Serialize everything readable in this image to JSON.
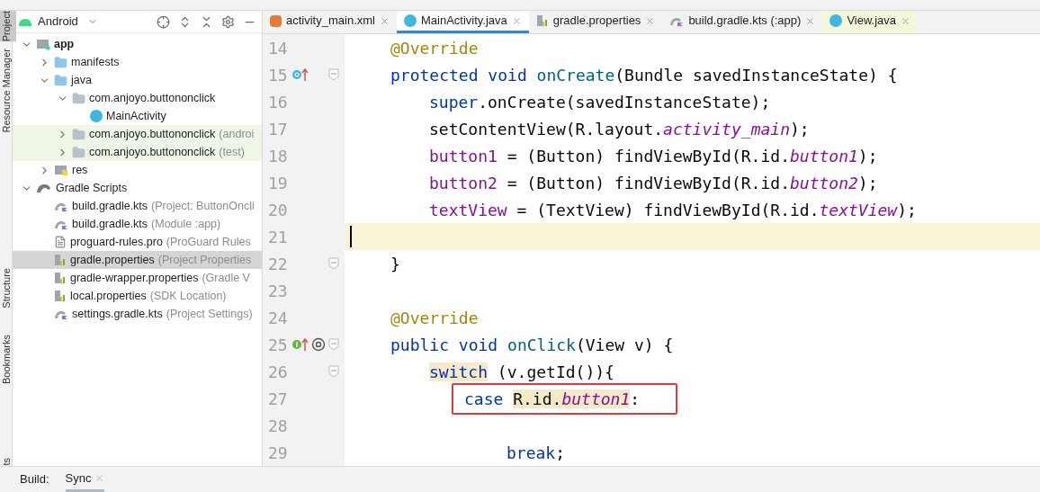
{
  "tool_strip": [
    {
      "label": "Project",
      "selected": true
    },
    {
      "label": "Resource Manager",
      "selected": false
    },
    {
      "label": "Structure",
      "selected": false
    },
    {
      "label": "Bookmarks",
      "selected": false
    },
    {
      "label": "ts",
      "selected": false
    }
  ],
  "project_panel": {
    "view": "Android",
    "tree": [
      {
        "name": "app",
        "kind": "module",
        "expanded": true,
        "selected": false,
        "test": false,
        "children": [
          {
            "name": "manifests",
            "kind": "folder",
            "expanded": false,
            "selected": false,
            "test": false
          },
          {
            "name": "java",
            "kind": "folder",
            "expanded": true,
            "selected": false,
            "test": false,
            "children": [
              {
                "name": "com.anjoyo.buttononclick",
                "kind": "package",
                "expanded": true,
                "selected": false,
                "test": false,
                "children": [
                  {
                    "name": "MainActivity",
                    "kind": "class",
                    "selected": false,
                    "test": false
                  }
                ]
              },
              {
                "name": "com.anjoyo.buttononclick",
                "note": "(androi",
                "kind": "package",
                "expanded": false,
                "selected": false,
                "test": true
              },
              {
                "name": "com.anjoyo.buttononclick",
                "note": "(test)",
                "kind": "package",
                "expanded": false,
                "selected": false,
                "test": true
              }
            ]
          },
          {
            "name": "res",
            "kind": "res",
            "expanded": false,
            "selected": false,
            "test": false
          }
        ]
      },
      {
        "name": "Gradle Scripts",
        "kind": "gradle",
        "expanded": true,
        "selected": false,
        "test": false,
        "children": [
          {
            "name": "build.gradle.kts",
            "note": "(Project: ButtonOncli",
            "kind": "kts",
            "selected": false,
            "test": false
          },
          {
            "name": "build.gradle.kts",
            "note": "(Module :app)",
            "kind": "kts",
            "selected": false,
            "test": false
          },
          {
            "name": "proguard-rules.pro",
            "note": "(ProGuard Rules",
            "kind": "text",
            "selected": false,
            "test": false
          },
          {
            "name": "gradle.properties",
            "note": "(Project Properties",
            "kind": "properties",
            "selected": true,
            "test": false
          },
          {
            "name": "gradle-wrapper.properties",
            "note": "(Gradle V",
            "kind": "properties",
            "selected": false,
            "test": false
          },
          {
            "name": "local.properties",
            "note": "(SDK Location)",
            "kind": "properties",
            "selected": false,
            "test": false
          },
          {
            "name": "settings.gradle.kts",
            "note": "(Project Settings)",
            "kind": "kts",
            "selected": false,
            "test": false
          }
        ]
      }
    ]
  },
  "tabs": [
    {
      "label": "activity_main.xml",
      "kind": "xml",
      "selected": false,
      "readonly": false
    },
    {
      "label": "MainActivity.java",
      "kind": "class",
      "selected": true,
      "readonly": false
    },
    {
      "label": "gradle.properties",
      "kind": "properties",
      "selected": false,
      "readonly": false
    },
    {
      "label": "build.gradle.kts (:app)",
      "kind": "kts",
      "selected": false,
      "readonly": false
    },
    {
      "label": "View.java",
      "kind": "class",
      "selected": false,
      "readonly": true
    }
  ],
  "editor": {
    "lines": [
      {
        "number": "14",
        "kind": "member",
        "current": false,
        "boxed": false,
        "fold": false,
        "tokens": [
          {
            "text": "@Override",
            "kind": "annotation"
          }
        ]
      },
      {
        "number": "15",
        "kind": "member",
        "gutter_icons": [
          {
            "kind": "override"
          }
        ],
        "current": false,
        "boxed": false,
        "fold": true,
        "tokens": [
          {
            "text": "protected void ",
            "kind": "keyword"
          },
          {
            "text": "onCreate",
            "kind": "method"
          },
          {
            "text": "(Bundle savedInstanceState) {"
          }
        ]
      },
      {
        "number": "16",
        "kind": "statement",
        "current": false,
        "boxed": false,
        "fold": false,
        "tokens": [
          {
            "text": "super",
            "kind": "keyword"
          },
          {
            "text": ".onCreate(savedInstanceState);"
          }
        ]
      },
      {
        "number": "17",
        "kind": "statement",
        "current": false,
        "boxed": false,
        "fold": false,
        "tokens": [
          {
            "text": "setContentView(R.layout."
          },
          {
            "text": "activity_main",
            "kind": "static"
          },
          {
            "text": ");"
          }
        ]
      },
      {
        "number": "18",
        "kind": "statement",
        "current": false,
        "boxed": false,
        "fold": false,
        "tokens": [
          {
            "text": "button1",
            "kind": "field"
          },
          {
            "text": " = (Button) findViewById(R.id."
          },
          {
            "text": "button1",
            "kind": "static"
          },
          {
            "text": ");"
          }
        ]
      },
      {
        "number": "19",
        "kind": "statement",
        "current": false,
        "boxed": false,
        "fold": false,
        "tokens": [
          {
            "text": "button2",
            "kind": "field"
          },
          {
            "text": " = (Button) findViewById(R.id."
          },
          {
            "text": "button2",
            "kind": "static"
          },
          {
            "text": ");"
          }
        ]
      },
      {
        "number": "20",
        "kind": "statement",
        "current": false,
        "boxed": false,
        "fold": false,
        "tokens": [
          {
            "text": "textView",
            "kind": "field"
          },
          {
            "text": " = (TextView) findViewById(R.id."
          },
          {
            "text": "textView",
            "kind": "static"
          },
          {
            "text": ");"
          }
        ]
      },
      {
        "number": "21",
        "current": true,
        "boxed": false,
        "fold": false
      },
      {
        "number": "22",
        "kind": "member",
        "current": false,
        "boxed": false,
        "fold": true,
        "tokens": [
          {
            "text": "}"
          }
        ]
      },
      {
        "number": "23",
        "current": false,
        "boxed": false,
        "fold": false
      },
      {
        "number": "24",
        "kind": "member",
        "current": false,
        "boxed": false,
        "fold": false,
        "tokens": [
          {
            "text": "@Override",
            "kind": "annotation"
          }
        ]
      },
      {
        "number": "25",
        "kind": "member",
        "gutter_icons": [
          {
            "kind": "implement"
          },
          {
            "kind": "at"
          }
        ],
        "current": false,
        "boxed": false,
        "fold": true,
        "tokens": [
          {
            "text": "public void ",
            "kind": "keyword"
          },
          {
            "text": "onClick",
            "kind": "method"
          },
          {
            "text": "(View v) {"
          }
        ]
      },
      {
        "number": "26",
        "kind": "statement",
        "current": false,
        "boxed": false,
        "fold": true,
        "tokens": [
          {
            "text": "switch",
            "kind": "keyword",
            "highlight": true
          },
          {
            "text": " (v.getId()){",
            "highlight": false
          }
        ]
      },
      {
        "number": "27",
        "kind": "case",
        "current": false,
        "boxed": true,
        "fold": false,
        "tokens": [
          {
            "text": "case ",
            "kind": "keyword",
            "highlight": false
          },
          {
            "text": "R.id.",
            "highlight": true
          },
          {
            "text": "button1",
            "kind": "static",
            "highlight": true
          },
          {
            "text": ":",
            "highlight": false
          }
        ]
      },
      {
        "number": "28",
        "current": false,
        "boxed": false,
        "fold": false
      },
      {
        "number": "29",
        "kind": "case_body",
        "current": false,
        "boxed": false,
        "fold": false,
        "tokens": [
          {
            "text": "break",
            "kind": "keyword"
          },
          {
            "text": ";"
          }
        ]
      }
    ]
  },
  "bottom_bar": {
    "label": "Build:",
    "tabs": [
      {
        "label": "Sync",
        "selected": true
      }
    ]
  }
}
